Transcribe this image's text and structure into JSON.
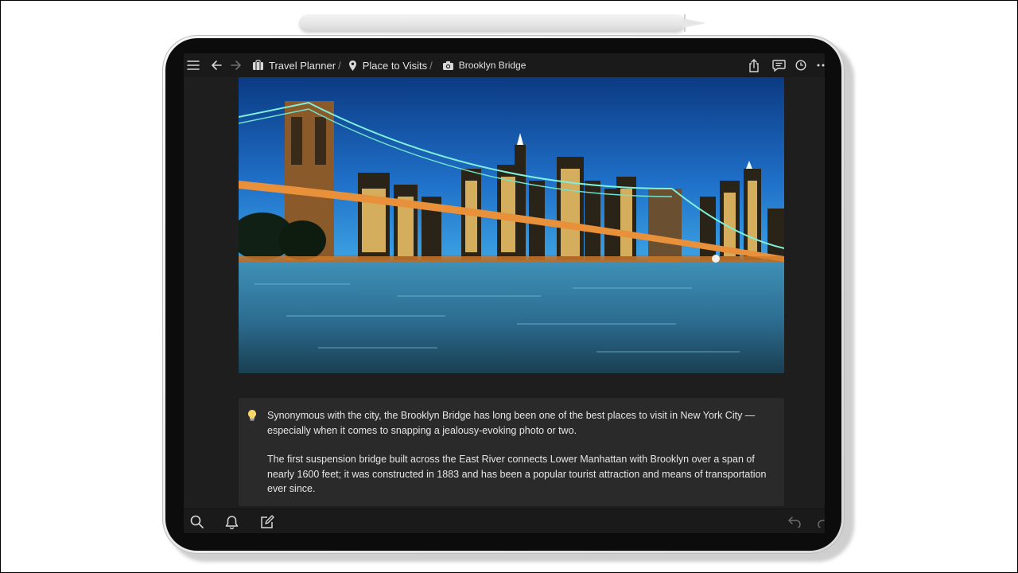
{
  "breadcrumb": {
    "items": [
      {
        "label": "Travel Planner",
        "icon": "briefcase-icon"
      },
      {
        "label": "Place to Visits",
        "icon": "map-pin-icon"
      },
      {
        "label": "Brooklyn Bridge",
        "icon": "camera-icon"
      }
    ],
    "separator": "/"
  },
  "toolbar": {
    "left_icons": [
      "menu-icon",
      "back-arrow-icon",
      "forward-arrow-icon"
    ],
    "right_icons": [
      "share-icon",
      "comment-icon",
      "history-icon",
      "more-icon"
    ]
  },
  "image": {
    "subject": "Brooklyn Bridge at night with Manhattan skyline"
  },
  "callout": {
    "icon": "lightbulb-icon",
    "paragraphs": [
      "Synonymous with the city, the Brooklyn Bridge has long been one of the best places to visit in New York City — especially when it comes to snapping a jealousy-evoking photo or two.",
      "The first suspension bridge built across the East River connects Lower Manhattan with Brooklyn over a span of nearly 1600 feet; it was constructed in 1883 and has been a popular tourist attraction and means of transportation ever since."
    ]
  },
  "bottom_toolbar": {
    "left_icons": [
      "search-icon",
      "bell-icon",
      "compose-icon"
    ],
    "right_icons": [
      "undo-icon",
      "redo-icon"
    ]
  },
  "colors": {
    "screen_bg": "#1e1e1e",
    "bar_bg": "#1a1a1a",
    "callout_bg": "#2a2a2a",
    "text": "#e6e6e6",
    "bulb": "#f5d76e"
  }
}
